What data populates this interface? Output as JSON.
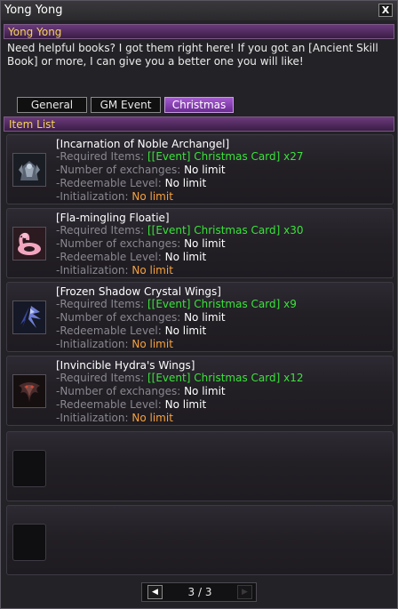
{
  "window": {
    "title": "Yong Yong",
    "close_glyph": "X"
  },
  "npc": {
    "name": "Yong Yong",
    "dialog": "Need helpful books? I got them right here! If you got an [Ancient Skill Book] or more, I can give you a better one you will like!"
  },
  "tabs": [
    {
      "label": "General",
      "active": false
    },
    {
      "label": "GM Event",
      "active": false
    },
    {
      "label": "Christmas",
      "active": true
    }
  ],
  "item_list": {
    "header": "Item List",
    "labels": {
      "required": "-Required Items: ",
      "exchanges": "-Number of exchanges: ",
      "level": "-Redeemable Level: ",
      "init": "-Initialization: "
    },
    "items": [
      {
        "name": "[Incarnation of Noble Archangel]",
        "required": "[[Event] Christmas Card] x27",
        "exchanges": "No limit",
        "level": "No limit",
        "init": "No limit",
        "icon": "armor-icon"
      },
      {
        "name": "[Fla-mingling Floatie]",
        "required": "[[Event] Christmas Card] x30",
        "exchanges": "No limit",
        "level": "No limit",
        "init": "No limit",
        "icon": "flamingo-floatie-icon"
      },
      {
        "name": "[Frozen Shadow Crystal Wings]",
        "required": "[[Event] Christmas Card] x9",
        "exchanges": "No limit",
        "level": "No limit",
        "init": "No limit",
        "icon": "crystal-wings-icon"
      },
      {
        "name": "[Invincible Hydra's Wings]",
        "required": "[[Event] Christmas Card] x12",
        "exchanges": "No limit",
        "level": "No limit",
        "init": "No limit",
        "icon": "hydra-wings-icon"
      }
    ],
    "empty_slots": 2
  },
  "pager": {
    "text": "3 / 3",
    "prev_glyph": "◀",
    "next_glyph": "▶"
  },
  "colors": {
    "accent_purple": "#6a2a92",
    "gold": "#f6d35a",
    "green": "#39e33a",
    "orange": "#f7a23c"
  }
}
